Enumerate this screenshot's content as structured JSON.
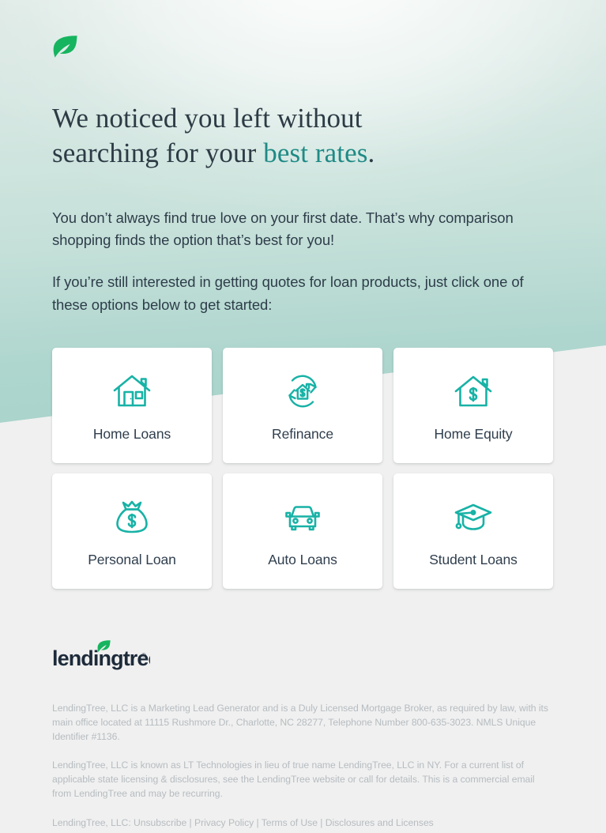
{
  "header": {
    "logo_icon": "lendingtree-leaf-icon"
  },
  "hero": {
    "headline_line1": "We noticed you left without",
    "headline_line2_prefix": "searching for your ",
    "headline_accent": "best rates",
    "headline_suffix": ".",
    "paragraph1": "You don’t always find true love on your first date. That’s why comparison shopping finds the option that’s best for you!",
    "paragraph2": "If you’re still interested in getting quotes for loan products, just click one of these options below to get started:"
  },
  "cards": [
    {
      "label": "Home Loans",
      "icon": "house-icon"
    },
    {
      "label": "Refinance",
      "icon": "house-refresh-dollar-icon"
    },
    {
      "label": "Home Equity",
      "icon": "house-dollar-icon"
    },
    {
      "label": "Personal Loan",
      "icon": "money-bag-dollar-icon"
    },
    {
      "label": "Auto Loans",
      "icon": "car-front-icon"
    },
    {
      "label": "Student Loans",
      "icon": "graduation-cap-icon"
    }
  ],
  "footer": {
    "logo_wordmark": "lendingtree",
    "logo_icon": "lendingtree-leaf-icon",
    "legal_paragraph1": "LendingTree, LLC is a Marketing Lead Generator and is a Duly Licensed Mortgage Broker, as required by law, with its main office located at 11115 Rushmore Dr., Charlotte, NC 28277, Telephone Number 800-635-3023. NMLS Unique Identifier #1136.",
    "legal_paragraph2": "LendingTree, LLC is known as LT Technologies in lieu of true name LendingTree, LLC in NY. For a current list of applicable state licensing & disclosures, see the LendingTree website or call for details. This is a commercial email from LendingTree and may be recurring.",
    "links_prefix": "LendingTree, LLC: ",
    "links": [
      {
        "label": "Unsubscribe"
      },
      {
        "label": "Privacy Policy"
      },
      {
        "label": "Terms of Use"
      },
      {
        "label": "Disclosures and Licenses"
      }
    ],
    "link_separator": " | "
  },
  "colors": {
    "brand_green": "#16b45f",
    "icon_teal": "#18b2a6",
    "accent_teal": "#1f8a85",
    "text_dark": "#2d3b45",
    "legal_grey": "#b6bcc0",
    "bg_teal": "#aed6ce",
    "bg_grey": "#f0f0f0",
    "card_white": "#ffffff",
    "wordmark_navy": "#1d2b3a"
  }
}
